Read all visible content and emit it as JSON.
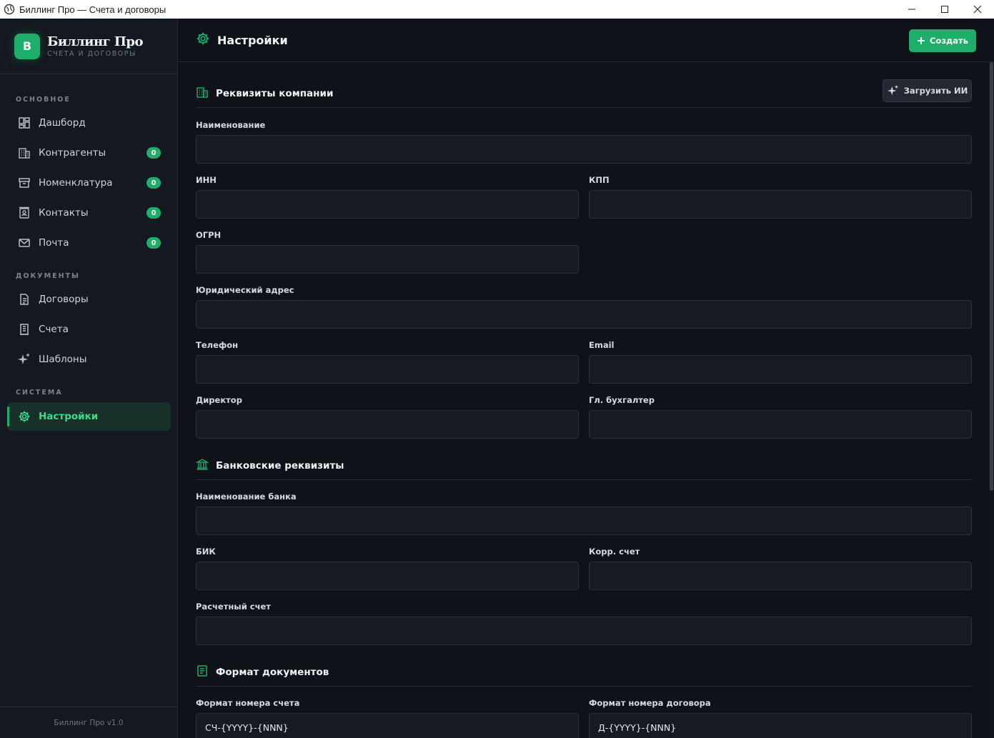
{
  "window": {
    "title": "Биллинг Про — Счета и договоры"
  },
  "brand": {
    "logo_letter": "B",
    "name": "Биллинг Про",
    "subtitle": "СЧЕТА И ДОГОВОРЫ"
  },
  "sidebar": {
    "sections": {
      "main": "ОСНОВНОЕ",
      "documents": "ДОКУМЕНТЫ",
      "system": "СИСТЕМА"
    },
    "items": [
      {
        "label": "Дашборд",
        "icon": "dashboard-icon"
      },
      {
        "label": "Контрагенты",
        "icon": "building-icon",
        "badge": "0"
      },
      {
        "label": "Номенклатура",
        "icon": "archive-icon",
        "badge": "0"
      },
      {
        "label": "Контакты",
        "icon": "contacts-icon",
        "badge": "0"
      },
      {
        "label": "Почта",
        "icon": "mail-icon",
        "badge": "0"
      },
      {
        "label": "Договоры",
        "icon": "document-icon"
      },
      {
        "label": "Счета",
        "icon": "receipt-icon"
      },
      {
        "label": "Шаблоны",
        "icon": "sparkles-icon"
      },
      {
        "label": "Настройки",
        "icon": "gear-icon",
        "active": true
      }
    ],
    "version": "Биллинг Про v1.0"
  },
  "header": {
    "title": "Настройки",
    "create_label": "Создать"
  },
  "company": {
    "title": "Реквизиты компании",
    "ai_button": "Загрузить ИИ",
    "fields": {
      "name": {
        "label": "Наименование",
        "value": ""
      },
      "inn": {
        "label": "ИНН",
        "value": ""
      },
      "kpp": {
        "label": "КПП",
        "value": ""
      },
      "ogrn": {
        "label": "ОГРН",
        "value": ""
      },
      "address": {
        "label": "Юридический адрес",
        "value": ""
      },
      "phone": {
        "label": "Телефон",
        "value": ""
      },
      "email": {
        "label": "Email",
        "value": ""
      },
      "director": {
        "label": "Директор",
        "value": ""
      },
      "accountant": {
        "label": "Гл. бухгалтер",
        "value": ""
      }
    }
  },
  "bank": {
    "title": "Банковские реквизиты",
    "fields": {
      "bank_name": {
        "label": "Наименование банка",
        "value": ""
      },
      "bik": {
        "label": "БИК",
        "value": ""
      },
      "corr": {
        "label": "Корр. счет",
        "value": ""
      },
      "account": {
        "label": "Расчетный счет",
        "value": ""
      }
    }
  },
  "format": {
    "title": "Формат документов",
    "fields": {
      "invoice": {
        "label": "Формат номера счета",
        "value": "СЧ-{YYYY}-{NNN}"
      },
      "contract": {
        "label": "Формат номера договора",
        "value": "Д-{YYYY}-{NNN}"
      }
    }
  },
  "colors": {
    "accent": "#1fae6a",
    "active_text": "#3ddc8b",
    "background": "#0f1218",
    "sidebar": "#141820"
  }
}
